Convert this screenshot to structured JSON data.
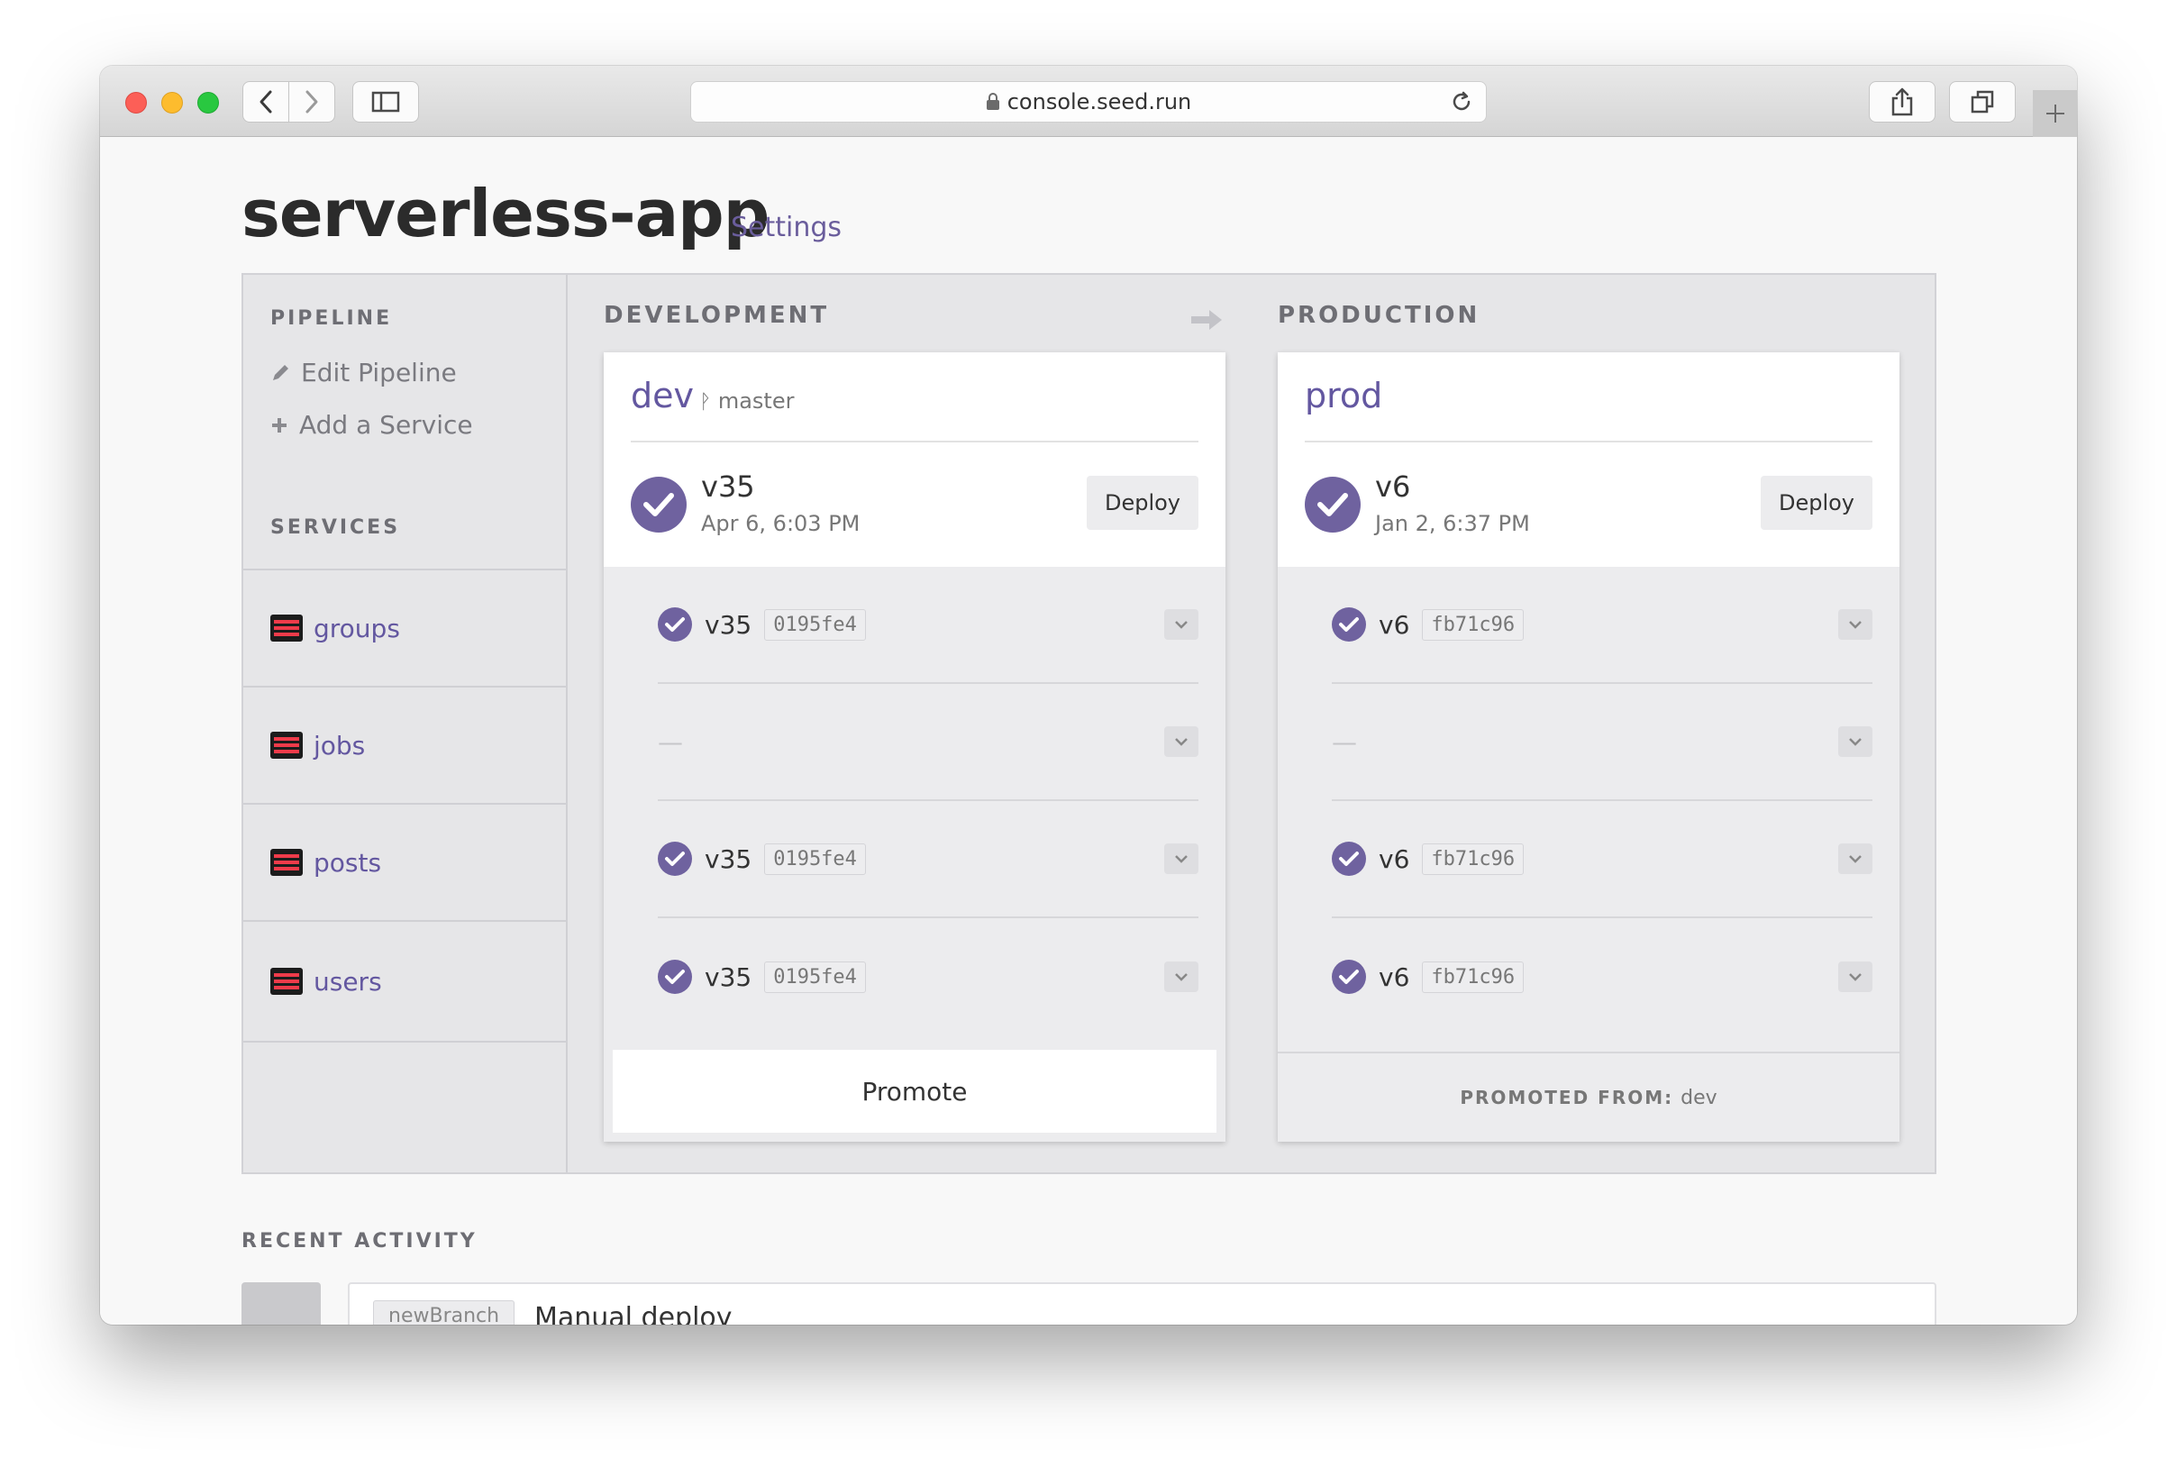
{
  "browser": {
    "url": "console.seed.run"
  },
  "app": {
    "title": "serverless-app",
    "settings_label": "Settings"
  },
  "sidebar": {
    "pipeline_label": "PIPELINE",
    "edit_pipeline": "Edit Pipeline",
    "add_service": "Add a Service",
    "services_label": "SERVICES",
    "services": [
      "groups",
      "jobs",
      "posts",
      "users"
    ]
  },
  "stages": {
    "development": {
      "label": "DEVELOPMENT",
      "name": "dev",
      "branch": "master",
      "version": "v35",
      "date": "Apr 6, 6:03 PM",
      "deploy_label": "Deploy",
      "rows": [
        {
          "version": "v35",
          "hash": "0195fe4"
        },
        {
          "version": "",
          "hash": "",
          "placeholder": "—"
        },
        {
          "version": "v35",
          "hash": "0195fe4"
        },
        {
          "version": "v35",
          "hash": "0195fe4"
        }
      ],
      "promote_label": "Promote"
    },
    "production": {
      "label": "PRODUCTION",
      "name": "prod",
      "version": "v6",
      "date": "Jan 2, 6:37 PM",
      "deploy_label": "Deploy",
      "rows": [
        {
          "version": "v6",
          "hash": "fb71c96"
        },
        {
          "version": "",
          "hash": "",
          "placeholder": "—"
        },
        {
          "version": "v6",
          "hash": "fb71c96"
        },
        {
          "version": "v6",
          "hash": "fb71c96"
        }
      ],
      "promoted_from_label": "PROMOTED FROM:",
      "promoted_from_value": "dev"
    }
  },
  "recent_activity": {
    "label": "RECENT ACTIVITY",
    "items": [
      {
        "branch": "newBranch",
        "title": "Manual deploy"
      }
    ]
  },
  "colors": {
    "accent": "#6357a0",
    "check": "#6f629f",
    "service_icon_red": "#ef3b4a"
  }
}
